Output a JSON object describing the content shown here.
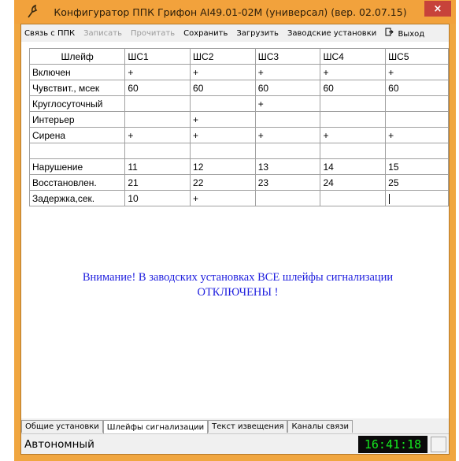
{
  "window": {
    "title": "Конфигуратор ППК Грифон AI49.01-02M (универсал) (вер. 02.07.15)",
    "close_glyph": "×"
  },
  "menu": [
    {
      "label": "Связь с ППК",
      "enabled": true
    },
    {
      "label": "Записать",
      "enabled": false
    },
    {
      "label": "Прочитать",
      "enabled": false
    },
    {
      "label": "Сохранить",
      "enabled": true
    },
    {
      "label": "Загрузить",
      "enabled": true
    },
    {
      "label": "Заводские установки",
      "enabled": true
    },
    {
      "label": "Выход",
      "enabled": true,
      "icon": "exit-icon"
    }
  ],
  "grid": {
    "header": [
      "Шлейф",
      "ШС1",
      "ШС2",
      "ШС3",
      "ШС4",
      "ШС5"
    ],
    "rows": [
      [
        "Включен",
        "+",
        "+",
        "+",
        "+",
        "+"
      ],
      [
        "Чувствит., мсек",
        "60",
        "60",
        "60",
        "60",
        "60"
      ],
      [
        "Круглосуточный",
        "",
        "",
        "+",
        "",
        ""
      ],
      [
        "Интерьер",
        "",
        "+",
        "",
        "",
        ""
      ],
      [
        "Сирена",
        "+",
        "+",
        "+",
        "+",
        "+"
      ],
      [
        "",
        "",
        "",
        "",
        "",
        ""
      ],
      [
        "Нарушение",
        "11",
        "12",
        "13",
        "14",
        "15"
      ],
      [
        "Восстановлен.",
        "21",
        "22",
        "23",
        "24",
        "25"
      ],
      [
        "Задержка,сек.",
        "10",
        "+",
        "",
        "",
        ""
      ]
    ]
  },
  "notice": {
    "line1": "Внимание! В заводских установках ВСЕ шлейфы сигнализации",
    "line2": "ОТКЛЮЧЕНЫ !"
  },
  "tabs": [
    {
      "label": "Общие установки",
      "active": false
    },
    {
      "label": "Шлейфы сигнализации",
      "active": true
    },
    {
      "label": "Текст извещения",
      "active": false
    },
    {
      "label": "Каналы связи",
      "active": false
    }
  ],
  "status": {
    "mode": "Автономный",
    "clock": "16:41:18"
  },
  "colors": {
    "title_bar": "#f2a23c",
    "close_button": "#c7423a",
    "notice_text": "#1d1dde",
    "clock_bg": "#0a0a0a",
    "clock_fg": "#15e81f"
  }
}
